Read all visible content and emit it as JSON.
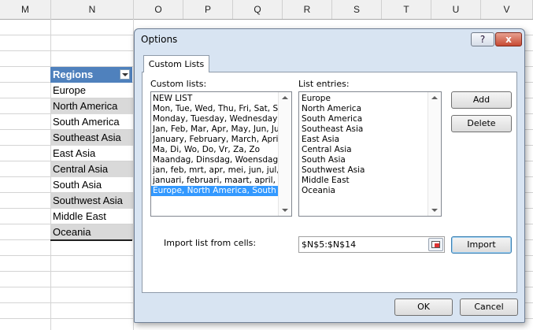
{
  "spreadsheet": {
    "columns": [
      "M",
      "N",
      "O",
      "P",
      "Q",
      "R",
      "S",
      "T",
      "U",
      "V"
    ],
    "table_header": "Regions",
    "regions": [
      "Europe",
      "North America",
      "South America",
      "Southeast Asia",
      "East Asia",
      "Central Asia",
      "South Asia",
      "Southwest Asia",
      "Middle East",
      "Oceania"
    ]
  },
  "dialog": {
    "title": "Options",
    "help_label": "?",
    "close_label": "x",
    "tab": "Custom Lists",
    "custom_lists_label": "Custom lists:",
    "custom_lists": [
      "NEW LIST",
      "Mon, Tue, Wed, Thu, Fri, Sat, S",
      "Monday, Tuesday, Wednesday,",
      "Jan, Feb, Mar, Apr, May, Jun, Ju",
      "January, February, March, Apri",
      "Ma, Di, Wo, Do, Vr, Za, Zo",
      "Maandag, Dinsdag, Woensdag",
      "jan, feb, mrt, apr, mei, jun, jul,",
      "januari, februari, maart, april, r",
      "Europe, North America, South"
    ],
    "selected_list_index": 9,
    "list_entries_label": "List entries:",
    "list_entries": [
      "Europe",
      "North America",
      "South America",
      "Southeast Asia",
      "East Asia",
      "Central Asia",
      "South Asia",
      "Southwest Asia",
      "Middle East",
      "Oceania"
    ],
    "add_label": "Add",
    "delete_label": "Delete",
    "import_from_label": "Import list from cells:",
    "import_range": "$N$5:$N$14",
    "import_label": "Import",
    "ok_label": "OK",
    "cancel_label": "Cancel"
  },
  "colors": {
    "header_blue": "#4f81bd",
    "selection_blue": "#3399ff",
    "dialog_frame": "#d8e4f2",
    "close_red": "#c74a33"
  }
}
